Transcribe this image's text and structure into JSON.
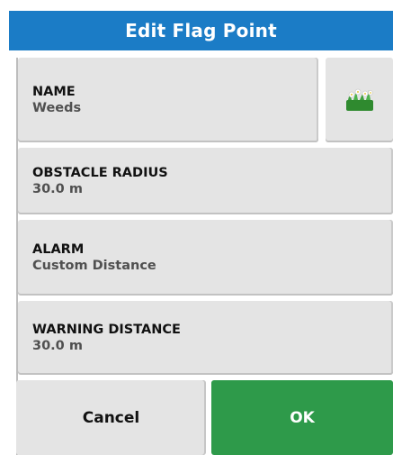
{
  "dialog": {
    "title": "Edit Flag Point"
  },
  "fields": {
    "name": {
      "label": "NAME",
      "value": "Weeds",
      "icon": "weeds-flag-icon"
    },
    "obstacle_radius": {
      "label": "OBSTACLE RADIUS",
      "value": "30.0 m"
    },
    "alarm": {
      "label": "ALARM",
      "value": "Custom Distance"
    },
    "warning_distance": {
      "label": "WARNING DISTANCE",
      "value": "30.0 m"
    }
  },
  "buttons": {
    "cancel_label": "Cancel",
    "ok_label": "OK"
  },
  "colors": {
    "header": "#1b7cc6",
    "ok": "#2e9a4a",
    "field_bg": "#e4e4e4"
  }
}
